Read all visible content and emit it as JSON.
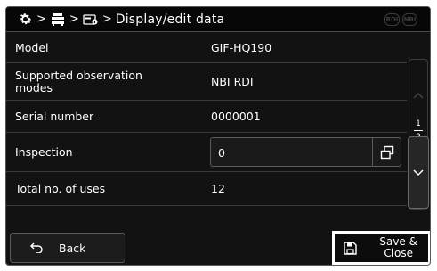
{
  "header": {
    "breadcrumb_sep": ">",
    "title": "Display/edit data",
    "icons": [
      "gear-icon",
      "cart-icon",
      "scope-tag-icon"
    ],
    "badges": [
      "RDI",
      "NBI"
    ]
  },
  "rows": [
    {
      "label": "Model",
      "value": "GIF-HQ190"
    },
    {
      "label": "Supported observation modes",
      "value": "NBI RDI"
    },
    {
      "label": "Serial number",
      "value": "0000001"
    },
    {
      "label": "Inspection",
      "value": "0"
    },
    {
      "label": "Total no. of uses",
      "value": "12"
    }
  ],
  "pager": {
    "current": "1",
    "total": "3"
  },
  "footer": {
    "back_label": "Back",
    "save_label_line1": "Save &",
    "save_label_line2": "Close"
  }
}
